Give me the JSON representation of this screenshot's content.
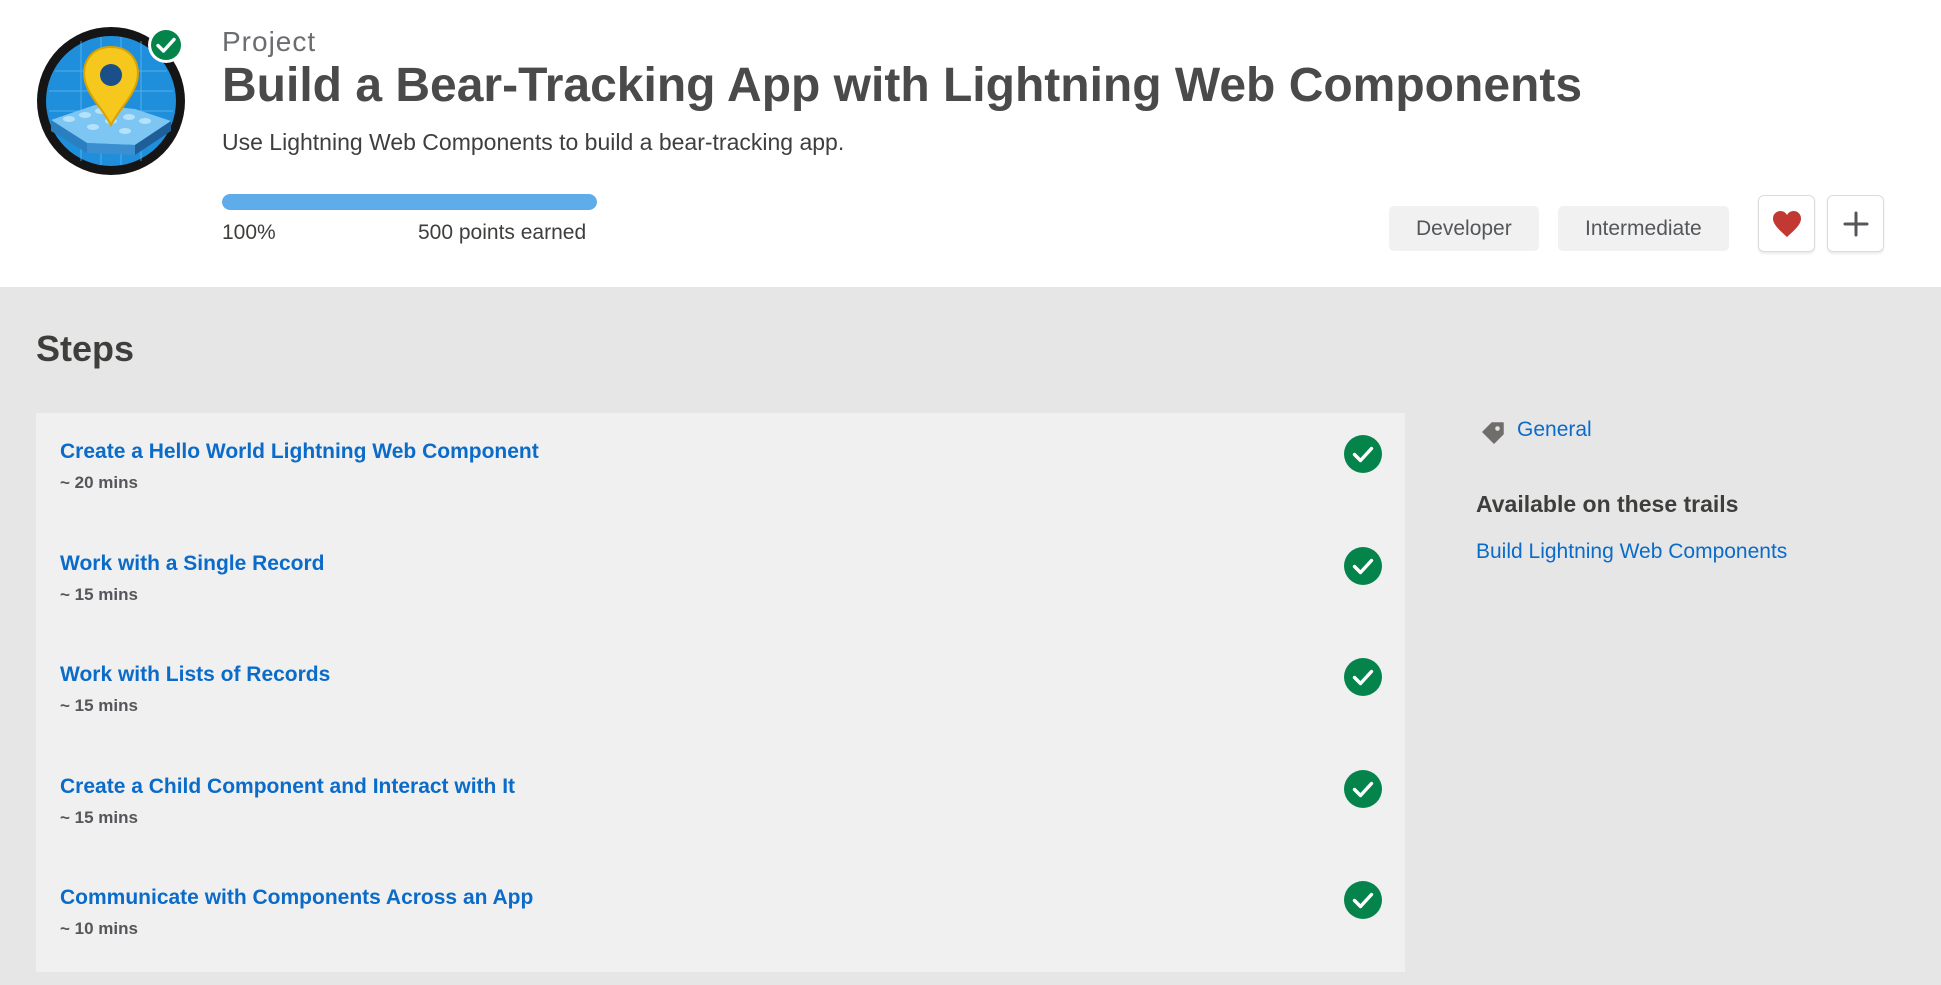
{
  "header": {
    "eyebrow": "Project",
    "title": "Build a Bear-Tracking App with Lightning Web Components",
    "subtitle": "Use Lightning Web Components to build a bear-tracking app.",
    "progress": {
      "percent_value": 100,
      "percent_label": "100%",
      "points_label": "500 points earned"
    },
    "tags": [
      "Developer",
      "Intermediate"
    ],
    "favorite_icon": "heart-icon",
    "add_icon": "plus-icon",
    "badge_icon": "map-pin-badge-icon"
  },
  "steps": {
    "heading": "Steps",
    "items": [
      {
        "title": "Create a Hello World Lightning Web Component",
        "time": "~ 20 mins"
      },
      {
        "title": "Work with a Single Record",
        "time": "~ 15 mins"
      },
      {
        "title": "Work with Lists of Records",
        "time": "~ 15 mins"
      },
      {
        "title": "Create a Child Component and Interact with It",
        "time": "~ 15 mins"
      },
      {
        "title": "Communicate with Components Across an App",
        "time": "~ 10 mins"
      }
    ]
  },
  "sidebar": {
    "tag_icon": "tag-icon",
    "tag": "General",
    "trails_heading": "Available on these trails",
    "trails": [
      "Build Lightning Web Components"
    ]
  },
  "colors": {
    "link": "#0b6bc9",
    "progress": "#5eacea",
    "complete": "#04844b",
    "heart": "#c23934"
  }
}
